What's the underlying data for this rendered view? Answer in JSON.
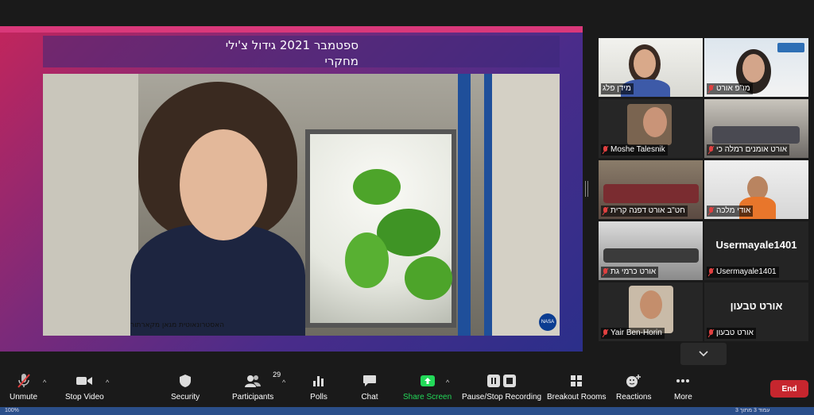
{
  "slide": {
    "title_line1": "ספטמבר 2021  גידול צ'ילי",
    "title_line2": "מחקרי",
    "photo_caption": "האסטרונאוטית מגאן מקארתור",
    "nasa_logo": "NASA"
  },
  "gallery": {
    "tiles": [
      {
        "name": "מידן פלג",
        "muted": false,
        "active": true
      },
      {
        "name": "מו\"פ אורט",
        "muted": true,
        "active": false
      },
      {
        "name": "Moshe Talesnik",
        "muted": true,
        "active": false
      },
      {
        "name": "אורט אומנים רמלה כי",
        "muted": true,
        "active": false
      },
      {
        "name": "חט\"ב אורט דפנה קרית",
        "muted": true,
        "active": false
      },
      {
        "name": "אודי מלכה",
        "muted": true,
        "active": false
      },
      {
        "name": "אורט כרמי גת",
        "muted": true,
        "active": false
      },
      {
        "name": "Usermayale1401",
        "big": "Usermayale1401",
        "muted": true,
        "active": false
      },
      {
        "name": "Yair Ben-Horin",
        "muted": true,
        "active": false
      },
      {
        "name": "אורט טבעון",
        "big": "אורט טבעון",
        "muted": true,
        "active": false
      }
    ],
    "next_icon": "chevron-down-icon"
  },
  "toolbar": {
    "unmute": "Unmute",
    "stop_video": "Stop Video",
    "security": "Security",
    "participants": "Participants",
    "participants_count": "29",
    "polls": "Polls",
    "chat": "Chat",
    "share_screen": "Share Screen",
    "record": "Pause/Stop Recording",
    "breakout": "Breakout Rooms",
    "reactions": "Reactions",
    "more": "More",
    "end": "End"
  },
  "colors": {
    "accent_green": "#23d959",
    "end_red": "#c6262e",
    "active_speaker": "#c8e05a"
  },
  "taskbar": {
    "zoom": "100%",
    "status": "עמוד 3 מתוך 3"
  }
}
